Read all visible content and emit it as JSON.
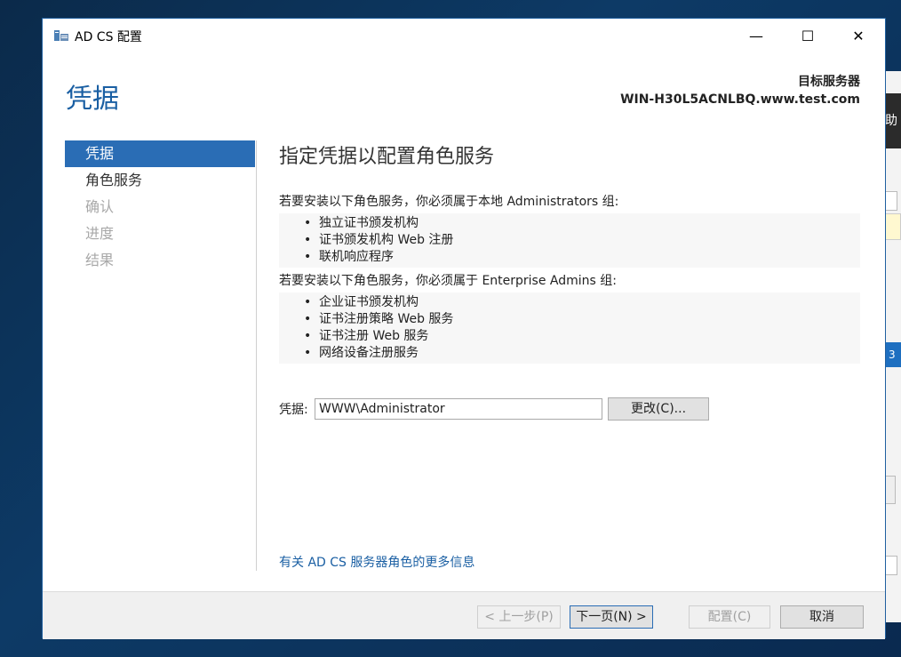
{
  "window": {
    "title": "AD CS 配置",
    "controls": {
      "minimize": "—",
      "maximize": "☐",
      "close": "✕"
    }
  },
  "header": {
    "page_title": "凭据",
    "target_label": "目标服务器",
    "target_server": "WIN-H30L5ACNLBQ.www.test.com"
  },
  "nav": {
    "items": [
      {
        "label": "凭据",
        "state": "active"
      },
      {
        "label": "角色服务",
        "state": "enabled"
      },
      {
        "label": "确认",
        "state": "disabled"
      },
      {
        "label": "进度",
        "state": "disabled"
      },
      {
        "label": "结果",
        "state": "disabled"
      }
    ]
  },
  "main": {
    "heading": "指定凭据以配置角色服务",
    "local_admin_text": "若要安装以下角色服务，你必须属于本地 Administrators 组:",
    "local_admin_services": [
      "独立证书颁发机构",
      "证书颁发机构 Web 注册",
      "联机响应程序"
    ],
    "enterprise_admin_text": "若要安装以下角色服务，你必须属于 Enterprise Admins 组:",
    "enterprise_admin_services": [
      "企业证书颁发机构",
      "证书注册策略 Web 服务",
      "证书注册 Web 服务",
      "网络设备注册服务"
    ],
    "credential_label": "凭据:",
    "credential_value": "WWW\\Administrator",
    "change_button": "更改(C)...",
    "more_info_link": "有关 AD CS 服务器角色的更多信息"
  },
  "footer": {
    "prev_button": "< 上一步(P)",
    "next_button": "下一页(N) >",
    "configure_button": "配置(C)",
    "cancel_button": "取消"
  },
  "background_app": {
    "partial_text_1": "助",
    "partial_text_2": "3"
  },
  "colors": {
    "accent": "#2a6db5",
    "title_blue": "#1a5fa3",
    "desktop": "#0d3a66"
  }
}
